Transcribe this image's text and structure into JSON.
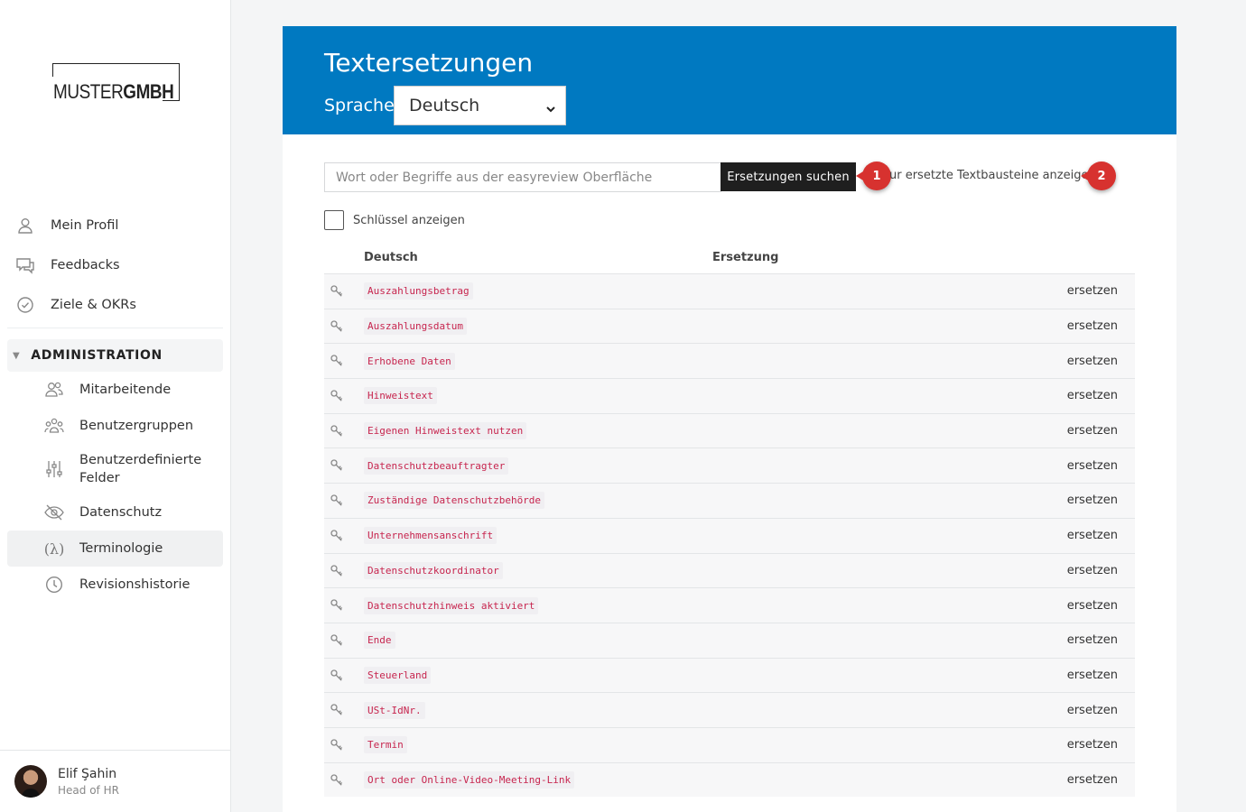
{
  "logo": {
    "light": "MUSTER",
    "bold": "GMBH"
  },
  "nav": {
    "items": [
      {
        "label": "Mein Profil",
        "icon": "user-icon"
      },
      {
        "label": "Feedbacks",
        "icon": "chat-icon"
      },
      {
        "label": "Ziele & OKRs",
        "icon": "check-circle-icon"
      }
    ],
    "admin_header": "ADMINISTRATION",
    "admin_items": [
      {
        "label": "Mitarbeitende",
        "icon": "people-icon"
      },
      {
        "label": "Benutzergruppen",
        "icon": "group-icon"
      },
      {
        "label": "Benutzerdefinierte Felder",
        "icon": "sliders-icon"
      },
      {
        "label": "Datenschutz",
        "icon": "eye-off-icon"
      },
      {
        "label": "Terminologie",
        "icon": "function-icon",
        "active": true
      },
      {
        "label": "Revisionshistorie",
        "icon": "clock-icon"
      }
    ]
  },
  "user": {
    "name": "Elif Şahin",
    "role": "Head of HR"
  },
  "page": {
    "title": "Textersetzungen",
    "language_label": "Sprache:",
    "language_value": "Deutsch",
    "search_placeholder": "Wort oder Begriffe aus der easyreview Oberfläche",
    "search_button": "Ersetzungen suchen",
    "filter_link": "ur ersetzte Textbausteine anzeigen",
    "marker_1": "1",
    "marker_2": "2",
    "checkbox_label": "Schlüssel anzeigen",
    "columns": {
      "source": "Deutsch",
      "replacement": "Ersetzung"
    },
    "action_label": "ersetzen"
  },
  "rows": [
    "Auszahlungsbetrag",
    "Auszahlungsdatum",
    "Erhobene Daten",
    "Hinweistext",
    "Eigenen Hinweistext nutzen",
    "Datenschutzbeauftragter",
    "Zuständige Datenschutzbehörde",
    "Unternehmensanschrift",
    "Datenschutzkoordinator",
    "Datenschutzhinweis aktiviert",
    "Ende",
    "Steuerland",
    "USt-IdNr.",
    "Termin",
    "Ort oder Online-Video-Meeting-Link"
  ],
  "colors": {
    "banner": "#0079c1",
    "button": "#1f1f1f",
    "marker": "#d7322f",
    "code": "#c7254e"
  }
}
